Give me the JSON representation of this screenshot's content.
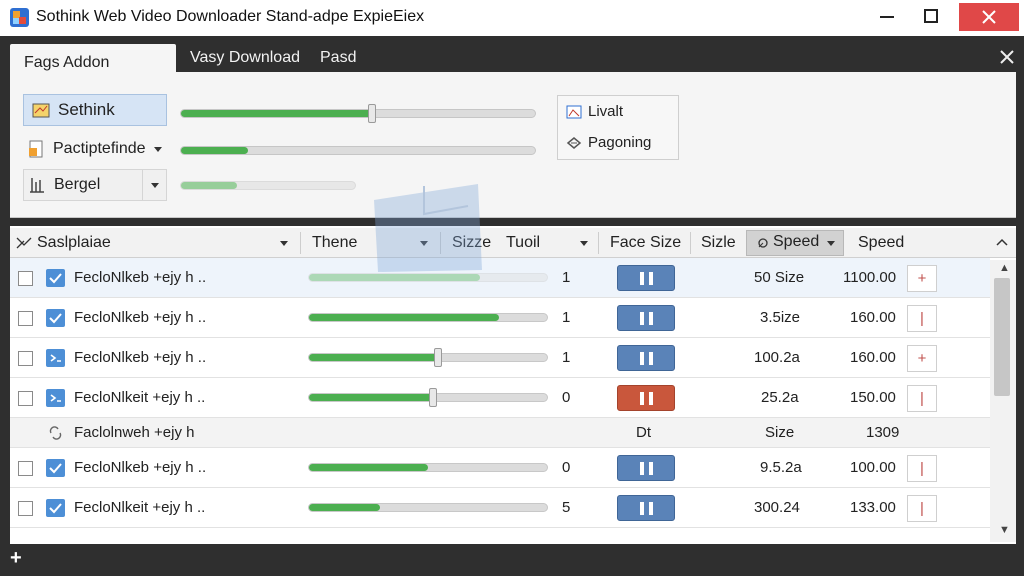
{
  "window": {
    "title": "Sothink Web Video Downloader Stand-adpe ExpieEiex",
    "controls": {
      "minimize_icon": "minimize-icon",
      "maximize_icon": "maximize-icon",
      "close_icon": "close-icon"
    }
  },
  "tabs": [
    {
      "label": "Fags Addon",
      "active": true
    },
    {
      "label": "Vasy Download",
      "active": false
    },
    {
      "label": "Pasd",
      "active": false
    }
  ],
  "panel": {
    "options": [
      {
        "label": "Sethink",
        "icon": "folder-icon",
        "selected": true
      },
      {
        "label": "Pactiptefinde",
        "icon": "document-icon",
        "dropdown": true
      },
      {
        "label": "Bergel",
        "icon": "tool-icon",
        "dropdown": true
      }
    ],
    "sliders": [
      {
        "level": 0.54
      },
      {
        "level": 0.19
      },
      {
        "level": 0.32
      }
    ],
    "side_items": [
      {
        "label": "Livalt",
        "icon": "image-icon"
      },
      {
        "label": "Pagoning",
        "icon": "link-icon"
      }
    ]
  },
  "table": {
    "headers": {
      "name": "Saslplaiae",
      "theme": "Thene",
      "size": "Sizze",
      "tool": "Tuoil",
      "face_size": "Face Size",
      "size2": "Sizle",
      "speed_active": "Speed",
      "speed": "Speed"
    },
    "rows": [
      {
        "name": "FecloNlkeb +ejy h ..",
        "progress": 0.72,
        "faded": true,
        "count": "1",
        "state": "blue",
        "size": "50 Size",
        "speed": "1100.00",
        "action": "+"
      },
      {
        "name": "FecloNlkeb +ejy h ..",
        "progress": 0.8,
        "count": "1",
        "state": "blue",
        "size": "3.5ize",
        "speed": "160.00",
        "action": "|"
      },
      {
        "name": "FecloNlkeb +ejy h ..",
        "progress": 0.54,
        "thumb": true,
        "count": "1",
        "state": "blue",
        "size": "100.2a",
        "speed": "160.00",
        "action": "+"
      },
      {
        "name": "FecloNlkeit +ejy h ..",
        "progress": 0.52,
        "thumb": true,
        "count": "0",
        "state": "red",
        "size": "25.2a",
        "speed": "150.00",
        "action": "|"
      },
      {
        "group": true,
        "name": "Faclolnweh +ejy h",
        "col_dt": "Dt",
        "col_size": "Size",
        "col_value": "1309"
      },
      {
        "name": "FecloNlkeb +ejy h ..",
        "progress": 0.5,
        "count": "0",
        "state": "blue",
        "size": "9.5.2a",
        "speed": "100.00",
        "action": "|"
      },
      {
        "name": "FecloNlkeit +ejy h ..",
        "progress": 0.3,
        "count": "5",
        "state": "blue",
        "size": "300.24",
        "speed": "133.00",
        "action": "|"
      }
    ]
  },
  "bottom": {
    "add_label": "+"
  }
}
